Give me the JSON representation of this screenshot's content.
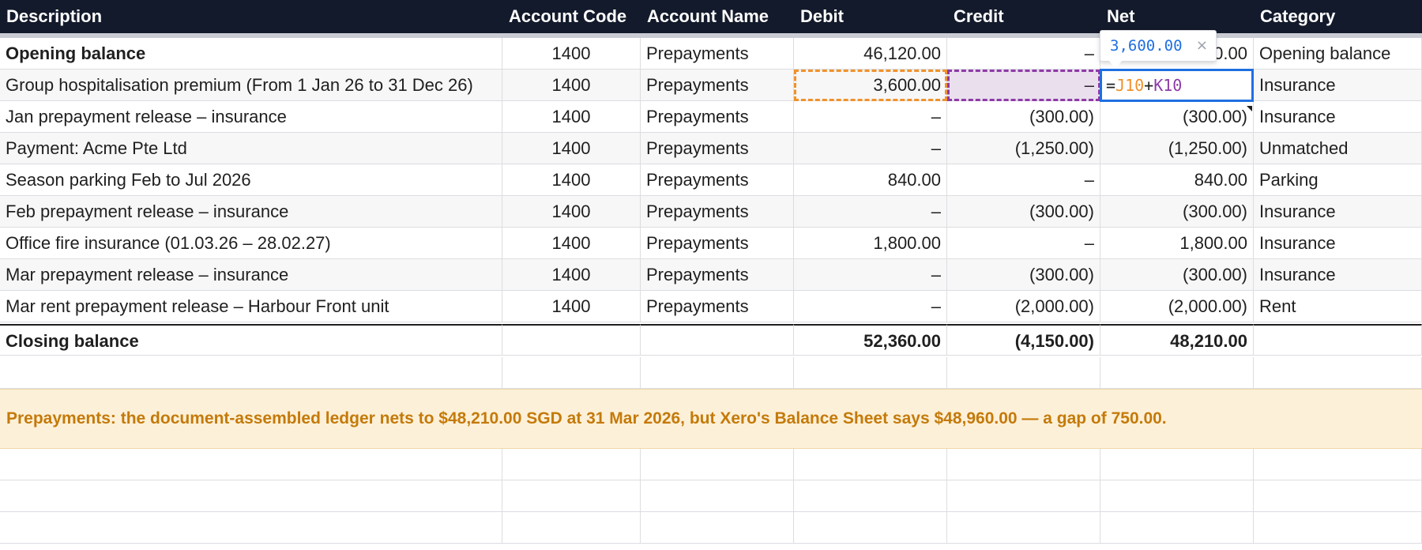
{
  "columns": [
    "Description",
    "Account Code",
    "Account Name",
    "Debit",
    "Credit",
    "Net",
    "Category"
  ],
  "rows": [
    {
      "description": "Opening balance",
      "code": "1400",
      "name": "Prepayments",
      "debit": "46,120.00",
      "credit": "–",
      "net": "46,120.00",
      "category": "Opening balance"
    },
    {
      "description": "Group hospitalisation premium (From 1 Jan 26 to 31 Dec 26)",
      "code": "1400",
      "name": "Prepayments",
      "debit": "3,600.00",
      "credit": "–",
      "net": "",
      "category": "Insurance"
    },
    {
      "description": "Jan prepayment release – insurance",
      "code": "1400",
      "name": "Prepayments",
      "debit": "–",
      "credit": "(300.00)",
      "net": "(300.00)",
      "category": "Insurance"
    },
    {
      "description": "Payment: Acme Pte Ltd",
      "code": "1400",
      "name": "Prepayments",
      "debit": "–",
      "credit": "(1,250.00)",
      "net": "(1,250.00)",
      "category": "Unmatched"
    },
    {
      "description": "Season parking Feb to Jul 2026",
      "code": "1400",
      "name": "Prepayments",
      "debit": "840.00",
      "credit": "–",
      "net": "840.00",
      "category": "Parking"
    },
    {
      "description": "Feb prepayment release – insurance",
      "code": "1400",
      "name": "Prepayments",
      "debit": "–",
      "credit": "(300.00)",
      "net": "(300.00)",
      "category": "Insurance"
    },
    {
      "description": "Office fire insurance (01.03.26 – 28.02.27)",
      "code": "1400",
      "name": "Prepayments",
      "debit": "1,800.00",
      "credit": "–",
      "net": "1,800.00",
      "category": "Insurance"
    },
    {
      "description": "Mar prepayment release – insurance",
      "code": "1400",
      "name": "Prepayments",
      "debit": "–",
      "credit": "(300.00)",
      "net": "(300.00)",
      "category": "Insurance"
    },
    {
      "description": "Mar rent prepayment release – Harbour Front unit",
      "code": "1400",
      "name": "Prepayments",
      "debit": "–",
      "credit": "(2,000.00)",
      "net": "(2,000.00)",
      "category": "Rent"
    }
  ],
  "totals": {
    "description": "Closing balance",
    "code": "",
    "name": "",
    "debit": "52,360.00",
    "credit": "(4,150.00)",
    "net": "48,210.00",
    "category": ""
  },
  "banner": "Prepayments: the document-assembled ledger nets to $48,210.00 SGD at 31 Mar 2026, but Xero's Balance Sheet says $48,960.00 — a gap of 750.00.",
  "editor": {
    "eq": "=",
    "ref_debit": "J10",
    "plus": "+",
    "ref_credit": "K10"
  },
  "tooltip": {
    "value": "3,600.00",
    "close": "×"
  },
  "colors": {
    "header_bg": "#131a2b",
    "banner_bg": "#fdf0d8",
    "banner_text": "#c47a0a",
    "active_border": "#1f6fe0",
    "debit_ref": "#f0922b",
    "credit_ref": "#8e3aa8"
  }
}
